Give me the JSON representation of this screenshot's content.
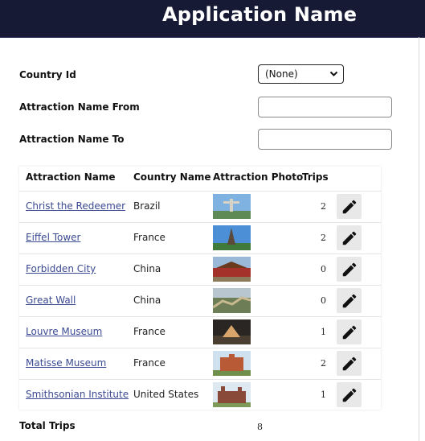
{
  "header": {
    "title": "Application Name"
  },
  "filters": {
    "country_label": "Country Id",
    "country_value": "(None)",
    "name_from_label": "Attraction Name From",
    "name_from_value": "",
    "name_to_label": "Attraction Name To",
    "name_to_value": ""
  },
  "grid": {
    "columns": [
      "Attraction Name",
      "Country Name",
      "Attraction Photo",
      "Trips"
    ],
    "rows": [
      {
        "name": "Christ the Redeemer",
        "country": "Brazil",
        "trips": "2",
        "photo": "christ-statue"
      },
      {
        "name": "Eiffel Tower",
        "country": "France",
        "trips": "2",
        "photo": "eiffel-tower"
      },
      {
        "name": "Forbidden City",
        "country": "China",
        "trips": "0",
        "photo": "forbidden-city"
      },
      {
        "name": "Great Wall",
        "country": "China",
        "trips": "0",
        "photo": "great-wall"
      },
      {
        "name": "Louvre Museum",
        "country": "France",
        "trips": "1",
        "photo": "louvre-pyramid"
      },
      {
        "name": "Matisse Museum",
        "country": "France",
        "trips": "2",
        "photo": "matisse-museum"
      },
      {
        "name": "Smithsonian Institute",
        "country": "United States",
        "trips": "1",
        "photo": "smithsonian"
      }
    ]
  },
  "totals": {
    "label": "Total Trips",
    "value": "8"
  },
  "icons": {
    "edit": "pencil-icon",
    "dropdown": "chevron-down-icon"
  },
  "colors": {
    "header_bg": "#161a35",
    "link": "#3b4a92",
    "edit_bg": "#e8e8e8"
  }
}
